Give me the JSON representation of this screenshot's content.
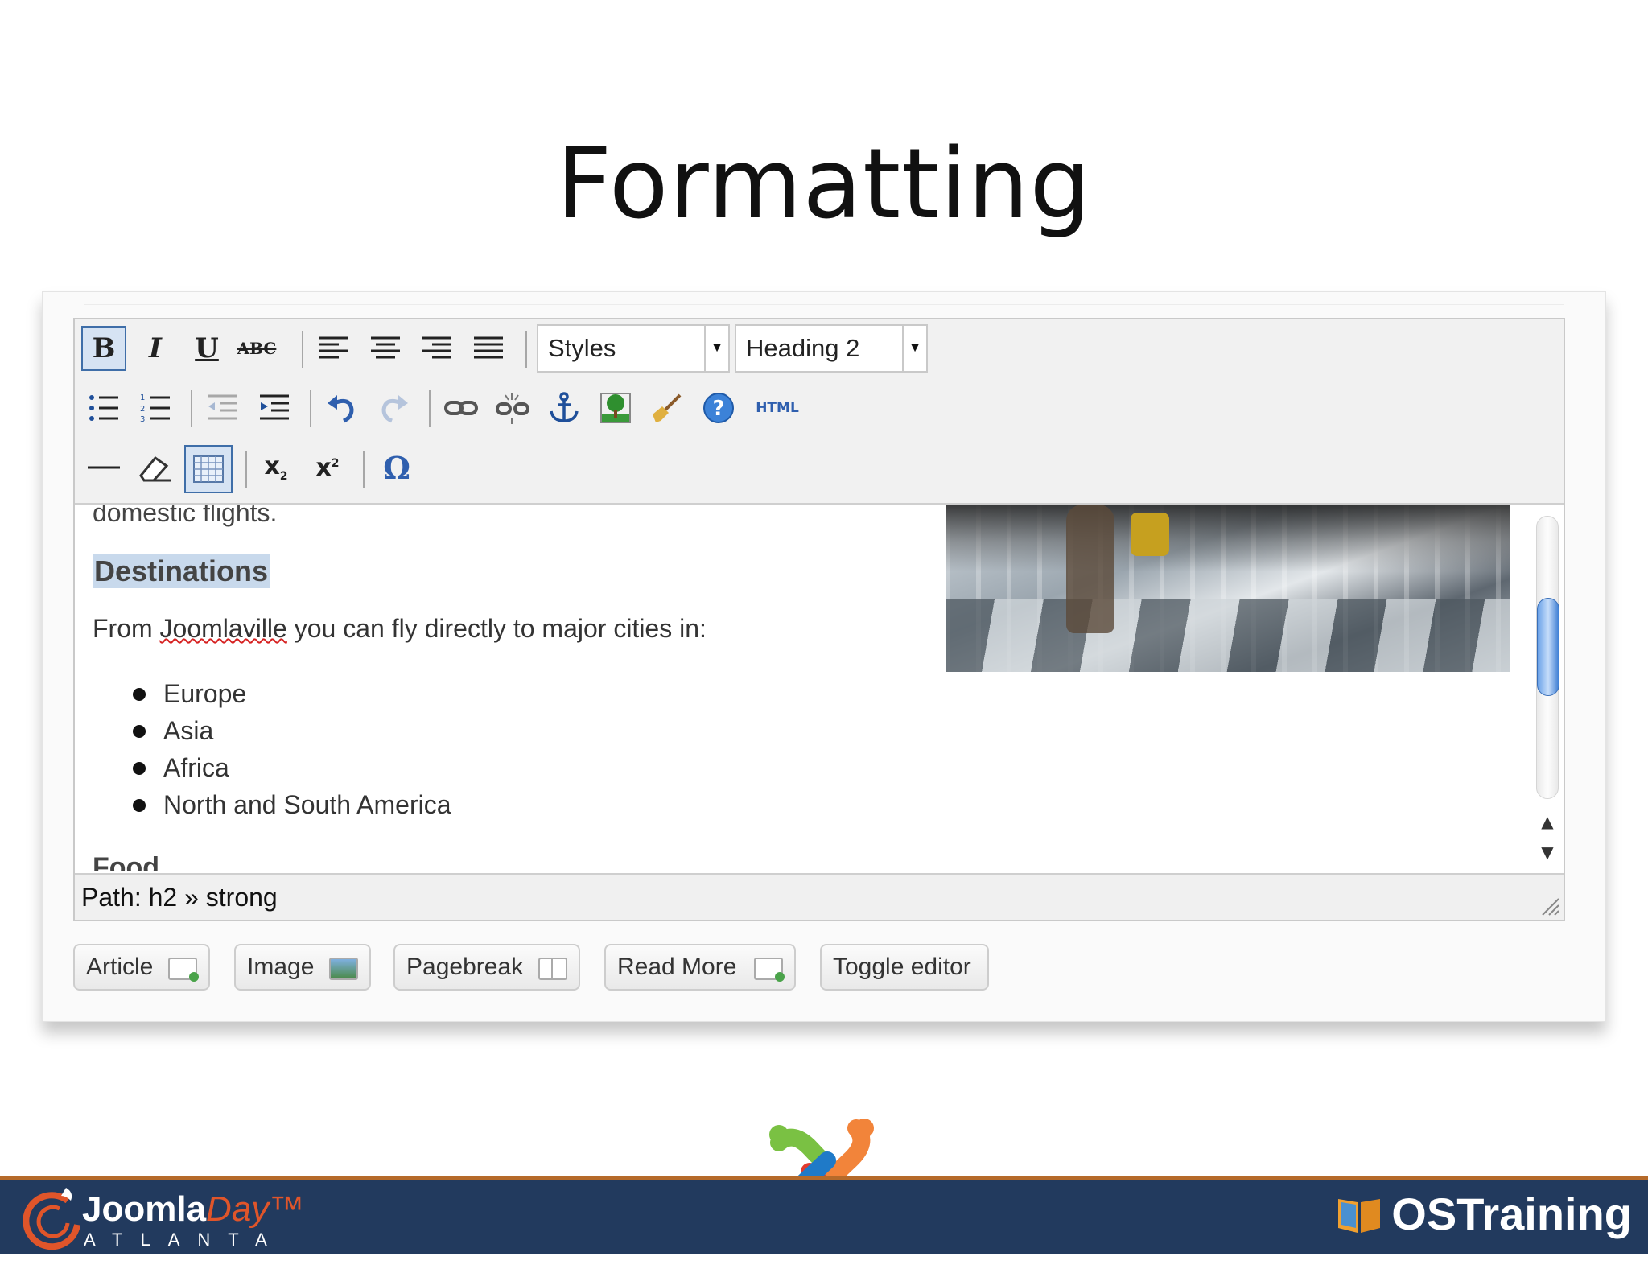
{
  "slide": {
    "title": "Formatting"
  },
  "toolbar": {
    "styles_select": "Styles",
    "format_select": "Heading 2",
    "html_label": "HTML"
  },
  "content": {
    "cut_top_text": "domestic flights.",
    "heading": "Destinations",
    "para_before": "From ",
    "para_misspelled": "Joomlaville",
    "para_after": " you can fly directly to major cities in:",
    "bullets": [
      "Europe",
      "Asia",
      "Africa",
      "North and South America"
    ],
    "cut_bottom_text": "Food"
  },
  "status": {
    "path": "Path: h2 » strong"
  },
  "buttons": {
    "article": "Article",
    "image": "Image",
    "pagebreak": "Pagebreak",
    "read_more": "Read More",
    "toggle_editor": "Toggle editor"
  },
  "footer": {
    "joomladay_name": "Joomla",
    "joomladay_day": "Day™",
    "joomladay_city": "ATLANTA",
    "ostraining": "OSTraining"
  },
  "colors": {
    "footer_bg": "#223a5e",
    "heading_highlight": "#c8d9ec",
    "active_button": "#3f6ea8"
  }
}
